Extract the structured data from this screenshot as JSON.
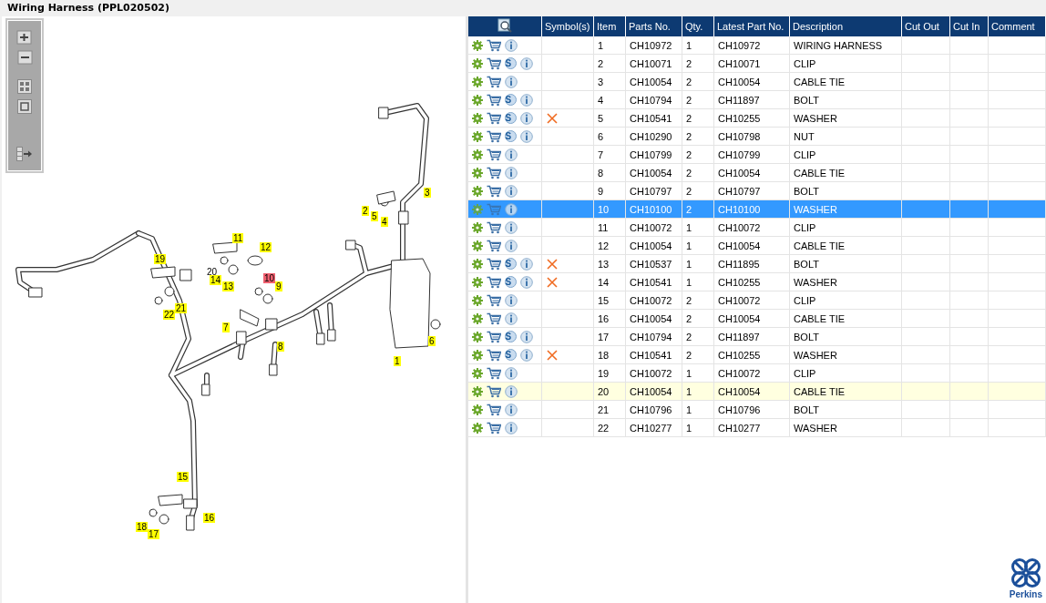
{
  "window": {
    "title": "Wiring Harness (PPL020502)"
  },
  "diagram": {
    "callouts": [
      {
        "label": "1",
        "kind": "tag"
      },
      {
        "label": "2",
        "kind": "tag"
      },
      {
        "label": "3",
        "kind": "tag"
      },
      {
        "label": "4",
        "kind": "tag"
      },
      {
        "label": "5",
        "kind": "tag"
      },
      {
        "label": "6",
        "kind": "tag"
      },
      {
        "label": "7",
        "kind": "tag"
      },
      {
        "label": "8",
        "kind": "tag"
      },
      {
        "label": "9",
        "kind": "tag"
      },
      {
        "label": "10",
        "kind": "active"
      },
      {
        "label": "11",
        "kind": "tag"
      },
      {
        "label": "12",
        "kind": "tag"
      },
      {
        "label": "13",
        "kind": "tag"
      },
      {
        "label": "14",
        "kind": "tag"
      },
      {
        "label": "15",
        "kind": "tag"
      },
      {
        "label": "16",
        "kind": "tag"
      },
      {
        "label": "17",
        "kind": "tag"
      },
      {
        "label": "18",
        "kind": "tag"
      },
      {
        "label": "19",
        "kind": "tag"
      },
      {
        "label": "20",
        "kind": "plain"
      },
      {
        "label": "21",
        "kind": "tag"
      },
      {
        "label": "22",
        "kind": "tag"
      }
    ]
  },
  "table": {
    "columns": [
      "Symbol(s)",
      "Item",
      "Parts No.",
      "Qty.",
      "Latest Part No.",
      "Description",
      "Cut Out",
      "Cut In",
      "Comment"
    ],
    "rows": [
      {
        "item": "1",
        "parts_no": "CH10972",
        "qty": "1",
        "latest_part_no": "CH10972",
        "description": "WIRING HARNESS",
        "flagged": false,
        "selected": false,
        "hovered": false
      },
      {
        "item": "2",
        "parts_no": "CH10071",
        "qty": "2",
        "latest_part_no": "CH10071",
        "description": "CLIP",
        "s_icon": "S",
        "flagged": false,
        "selected": false,
        "hovered": false
      },
      {
        "item": "3",
        "parts_no": "CH10054",
        "qty": "2",
        "latest_part_no": "CH10054",
        "description": "CABLE TIE",
        "flagged": false,
        "selected": false,
        "hovered": false
      },
      {
        "item": "4",
        "parts_no": "CH10794",
        "qty": "2",
        "latest_part_no": "CH11897",
        "description": "BOLT",
        "s_icon": "S",
        "flagged": false,
        "selected": false,
        "hovered": false
      },
      {
        "item": "5",
        "parts_no": "CH10541",
        "qty": "2",
        "latest_part_no": "CH10255",
        "description": "WASHER",
        "s_icon": "S",
        "flagged": true,
        "selected": false,
        "hovered": false
      },
      {
        "item": "6",
        "parts_no": "CH10290",
        "qty": "2",
        "latest_part_no": "CH10798",
        "description": "NUT",
        "s_icon": "S",
        "flagged": false,
        "selected": false,
        "hovered": false
      },
      {
        "item": "7",
        "parts_no": "CH10799",
        "qty": "2",
        "latest_part_no": "CH10799",
        "description": "CLIP",
        "flagged": false,
        "selected": false,
        "hovered": false
      },
      {
        "item": "8",
        "parts_no": "CH10054",
        "qty": "2",
        "latest_part_no": "CH10054",
        "description": "CABLE TIE",
        "flagged": false,
        "selected": false,
        "hovered": false
      },
      {
        "item": "9",
        "parts_no": "CH10797",
        "qty": "2",
        "latest_part_no": "CH10797",
        "description": "BOLT",
        "flagged": false,
        "selected": false,
        "hovered": false
      },
      {
        "item": "10",
        "parts_no": "CH10100",
        "qty": "2",
        "latest_part_no": "CH10100",
        "description": "WASHER",
        "flagged": false,
        "selected": true,
        "hovered": false
      },
      {
        "item": "11",
        "parts_no": "CH10072",
        "qty": "1",
        "latest_part_no": "CH10072",
        "description": "CLIP",
        "flagged": false,
        "selected": false,
        "hovered": false
      },
      {
        "item": "12",
        "parts_no": "CH10054",
        "qty": "1",
        "latest_part_no": "CH10054",
        "description": "CABLE TIE",
        "flagged": false,
        "selected": false,
        "hovered": false
      },
      {
        "item": "13",
        "parts_no": "CH10537",
        "qty": "1",
        "latest_part_no": "CH11895",
        "description": "BOLT",
        "s_icon": "S",
        "flagged": true,
        "selected": false,
        "hovered": false
      },
      {
        "item": "14",
        "parts_no": "CH10541",
        "qty": "1",
        "latest_part_no": "CH10255",
        "description": "WASHER",
        "s_icon": "S",
        "flagged": true,
        "selected": false,
        "hovered": false
      },
      {
        "item": "15",
        "parts_no": "CH10072",
        "qty": "2",
        "latest_part_no": "CH10072",
        "description": "CLIP",
        "flagged": false,
        "selected": false,
        "hovered": false
      },
      {
        "item": "16",
        "parts_no": "CH10054",
        "qty": "2",
        "latest_part_no": "CH10054",
        "description": "CABLE TIE",
        "flagged": false,
        "selected": false,
        "hovered": false
      },
      {
        "item": "17",
        "parts_no": "CH10794",
        "qty": "2",
        "latest_part_no": "CH11897",
        "description": "BOLT",
        "s_icon": "S",
        "flagged": false,
        "selected": false,
        "hovered": false
      },
      {
        "item": "18",
        "parts_no": "CH10541",
        "qty": "2",
        "latest_part_no": "CH10255",
        "description": "WASHER",
        "s_icon": "S",
        "flagged": true,
        "selected": false,
        "hovered": false
      },
      {
        "item": "19",
        "parts_no": "CH10072",
        "qty": "1",
        "latest_part_no": "CH10072",
        "description": "CLIP",
        "flagged": false,
        "selected": false,
        "hovered": false
      },
      {
        "item": "20",
        "parts_no": "CH10054",
        "qty": "1",
        "latest_part_no": "CH10054",
        "description": "CABLE TIE",
        "flagged": false,
        "selected": false,
        "hovered": true
      },
      {
        "item": "21",
        "parts_no": "CH10796",
        "qty": "1",
        "latest_part_no": "CH10796",
        "description": "BOLT",
        "flagged": false,
        "selected": false,
        "hovered": false
      },
      {
        "item": "22",
        "parts_no": "CH10277",
        "qty": "1",
        "latest_part_no": "CH10277",
        "description": "WASHER",
        "flagged": false,
        "selected": false,
        "hovered": false
      }
    ]
  },
  "logo": {
    "text": "Perkins"
  }
}
